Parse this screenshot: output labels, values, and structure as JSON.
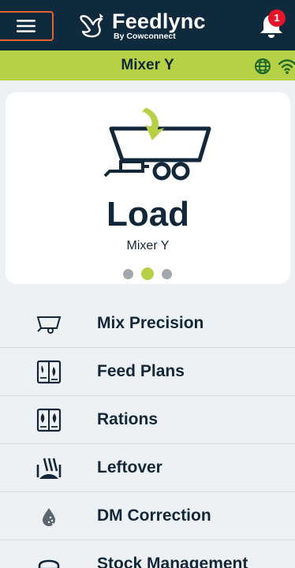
{
  "header": {
    "brand_name": "Feedlync",
    "brand_sub": "By Cowconnect",
    "notification_count": "1"
  },
  "device_bar": {
    "device_name": "Mixer Y"
  },
  "card": {
    "title": "Load",
    "subtitle": "Mixer Y",
    "active_page": 2,
    "page_count": 3
  },
  "menu": {
    "items": [
      {
        "label": "Mix Precision",
        "icon": "mixer-wagon-icon"
      },
      {
        "label": "Feed Plans",
        "icon": "feed-plan-book-icon"
      },
      {
        "label": "Rations",
        "icon": "ration-book-icon"
      },
      {
        "label": "Leftover",
        "icon": "leftover-icon"
      },
      {
        "label": "DM Correction",
        "icon": "water-drop-icon"
      },
      {
        "label": "Stock Management",
        "icon": "stock-icon"
      }
    ]
  },
  "colors": {
    "header_bg": "#0f2a3c",
    "accent_green": "#b7d147",
    "text_dark": "#12283a",
    "badge_red": "#e4152b",
    "menu_outline": "#e2612f"
  }
}
